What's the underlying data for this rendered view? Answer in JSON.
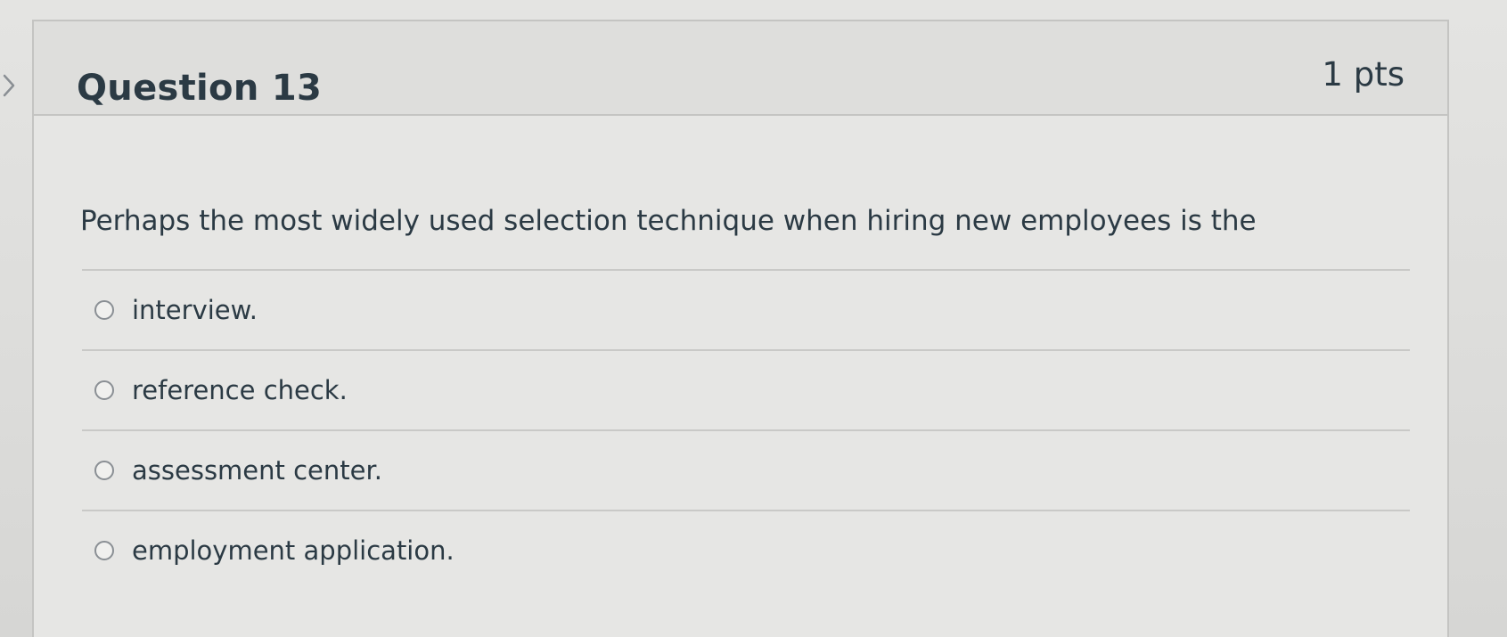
{
  "question": {
    "title": "Question 13",
    "points": "1 pts",
    "text": "Perhaps the most widely used selection technique when hiring new employees is the"
  },
  "answers": [
    {
      "label": "interview."
    },
    {
      "label": "reference check."
    },
    {
      "label": "assessment center."
    },
    {
      "label": "employment application."
    }
  ],
  "icons": {
    "collapse": "chevron-right-icon",
    "radio": "radio-unselected"
  },
  "colors": {
    "text": "#2b3a44",
    "border": "#c4c4c2",
    "header_bg": "#dededc"
  }
}
